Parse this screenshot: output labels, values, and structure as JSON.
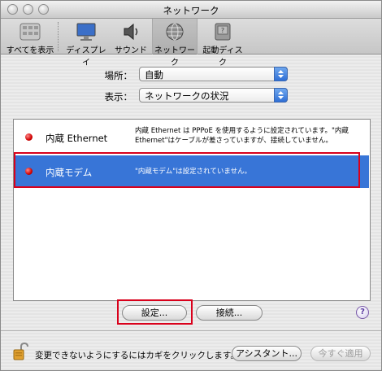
{
  "window": {
    "title": "ネットワーク"
  },
  "toolbar": {
    "items": [
      {
        "label": "すべてを表示",
        "icon": "apple-icon"
      },
      {
        "label": "ディスプレイ",
        "icon": "display-icon"
      },
      {
        "label": "サウンド",
        "icon": "speaker-icon"
      },
      {
        "label": "ネットワーク",
        "icon": "network-globe-icon",
        "selected": true
      },
      {
        "label": "起動ディスク",
        "icon": "disk-icon"
      }
    ]
  },
  "location": {
    "label": "場所：",
    "value": "自動"
  },
  "show": {
    "label": "表示：",
    "value": "ネットワークの状況"
  },
  "ports": [
    {
      "name": "内蔵 Ethernet",
      "status_color": "#cc0000",
      "description": "内蔵 Ethernet は PPPoE を使用するように設定されています。\"内蔵 Ethernet\"はケーブルが差さっていますが、接続していません。"
    },
    {
      "name": "内蔵モデム",
      "status_color": "#cc0000",
      "description": "\"内蔵モデム\"は設定されていません。",
      "selected": true
    }
  ],
  "buttons": {
    "configure": "設定...",
    "connect": "接続...",
    "help": "?",
    "assistant": "アシスタント...",
    "apply_now": "今すぐ適用"
  },
  "lock": {
    "text": "変更できないようにするにはカギをクリックします。"
  },
  "colors": {
    "selection": "#3875d7",
    "highlight_frame": "#d9001b"
  }
}
